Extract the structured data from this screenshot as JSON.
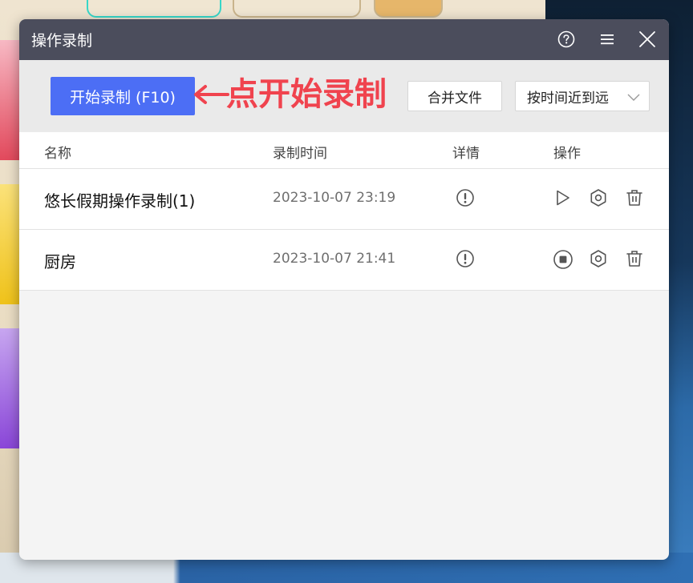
{
  "window": {
    "title": "操作录制"
  },
  "toolbar": {
    "start_label": "开始录制 (F10)",
    "annotation_text": "点开始录制",
    "merge_label": "合并文件",
    "sort_value": "按时间近到远"
  },
  "table": {
    "headers": {
      "name": "名称",
      "time": "录制时间",
      "detail": "详情",
      "actions": "操作"
    },
    "rows": [
      {
        "name": "悠长假期操作录制(1)",
        "time": "2023-10-07 23:19",
        "play_state": "play"
      },
      {
        "name": "厨房",
        "time": "2023-10-07 21:41",
        "play_state": "stop"
      }
    ]
  },
  "colors": {
    "titlebar": "#4b4d5c",
    "primary_button": "#4c6ef5",
    "annotation": "#f0434e"
  },
  "icons": {
    "help": "help-circle-icon",
    "menu": "hamburger-menu-icon",
    "close": "close-icon",
    "sort_chevron": "chevron-down-icon",
    "detail": "exclamation-circle-icon",
    "play": "play-icon",
    "stop": "stop-circle-icon",
    "settings": "hexagon-settings-icon",
    "delete": "trash-icon"
  }
}
